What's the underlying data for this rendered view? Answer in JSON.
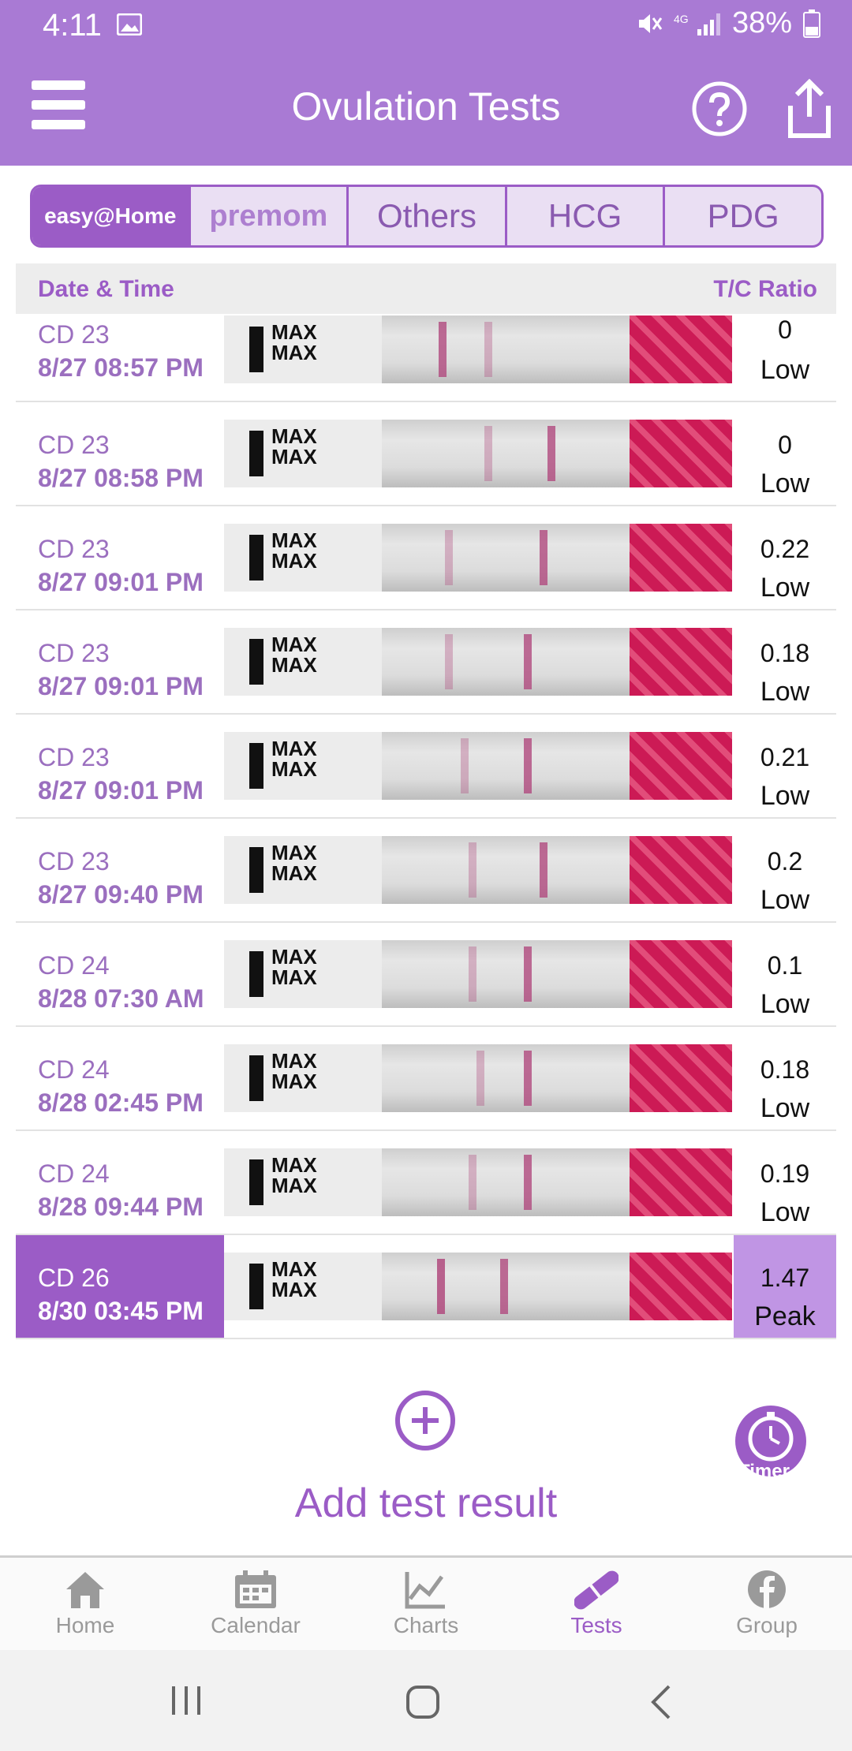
{
  "status": {
    "time": "4:11",
    "battery": "38%"
  },
  "app_bar": {
    "title": "Ovulation Tests"
  },
  "tabs": [
    {
      "label": "easy@Home",
      "active": true
    },
    {
      "label": "premom",
      "active": false
    },
    {
      "label": "Others",
      "active": false
    },
    {
      "label": "HCG",
      "active": false
    },
    {
      "label": "PDG",
      "active": false
    }
  ],
  "list_header": {
    "left": "Date & Time",
    "right": "T/C Ratio"
  },
  "rows": [
    {
      "cd": "CD 23",
      "datetime": "8/27  08:57 PM",
      "ratio": "0",
      "level": "Low"
    },
    {
      "cd": "CD 23",
      "datetime": "8/27  08:58 PM",
      "ratio": "0",
      "level": "Low"
    },
    {
      "cd": "CD 23",
      "datetime": "8/27  09:01 PM",
      "ratio": "0.22",
      "level": "Low"
    },
    {
      "cd": "CD 23",
      "datetime": "8/27  09:01 PM",
      "ratio": "0.18",
      "level": "Low"
    },
    {
      "cd": "CD 23",
      "datetime": "8/27  09:01 PM",
      "ratio": "0.21",
      "level": "Low"
    },
    {
      "cd": "CD 23",
      "datetime": "8/27  09:40 PM",
      "ratio": "0.2",
      "level": "Low"
    },
    {
      "cd": "CD 24",
      "datetime": "8/28  07:30 AM",
      "ratio": "0.1",
      "level": "Low"
    },
    {
      "cd": "CD 24",
      "datetime": "8/28  02:45 PM",
      "ratio": "0.18",
      "level": "Low"
    },
    {
      "cd": "CD 24",
      "datetime": "8/28  09:44 PM",
      "ratio": "0.19",
      "level": "Low"
    },
    {
      "cd": "CD 26",
      "datetime": "8/30  03:45 PM",
      "ratio": "1.47",
      "level": "Peak"
    }
  ],
  "strip_text": "MAX",
  "add": {
    "label": "Add test result"
  },
  "timer": {
    "label": "Timer"
  },
  "bottom_nav": [
    {
      "label": "Home",
      "icon": "home-icon"
    },
    {
      "label": "Calendar",
      "icon": "calendar-icon"
    },
    {
      "label": "Charts",
      "icon": "chart-icon"
    },
    {
      "label": "Tests",
      "icon": "test-strip-icon",
      "active": true
    },
    {
      "label": "Group",
      "icon": "facebook-icon"
    }
  ],
  "colors": {
    "brand": "#a97ad4",
    "accent": "#9b5cc6",
    "peak": "#c095e4"
  }
}
